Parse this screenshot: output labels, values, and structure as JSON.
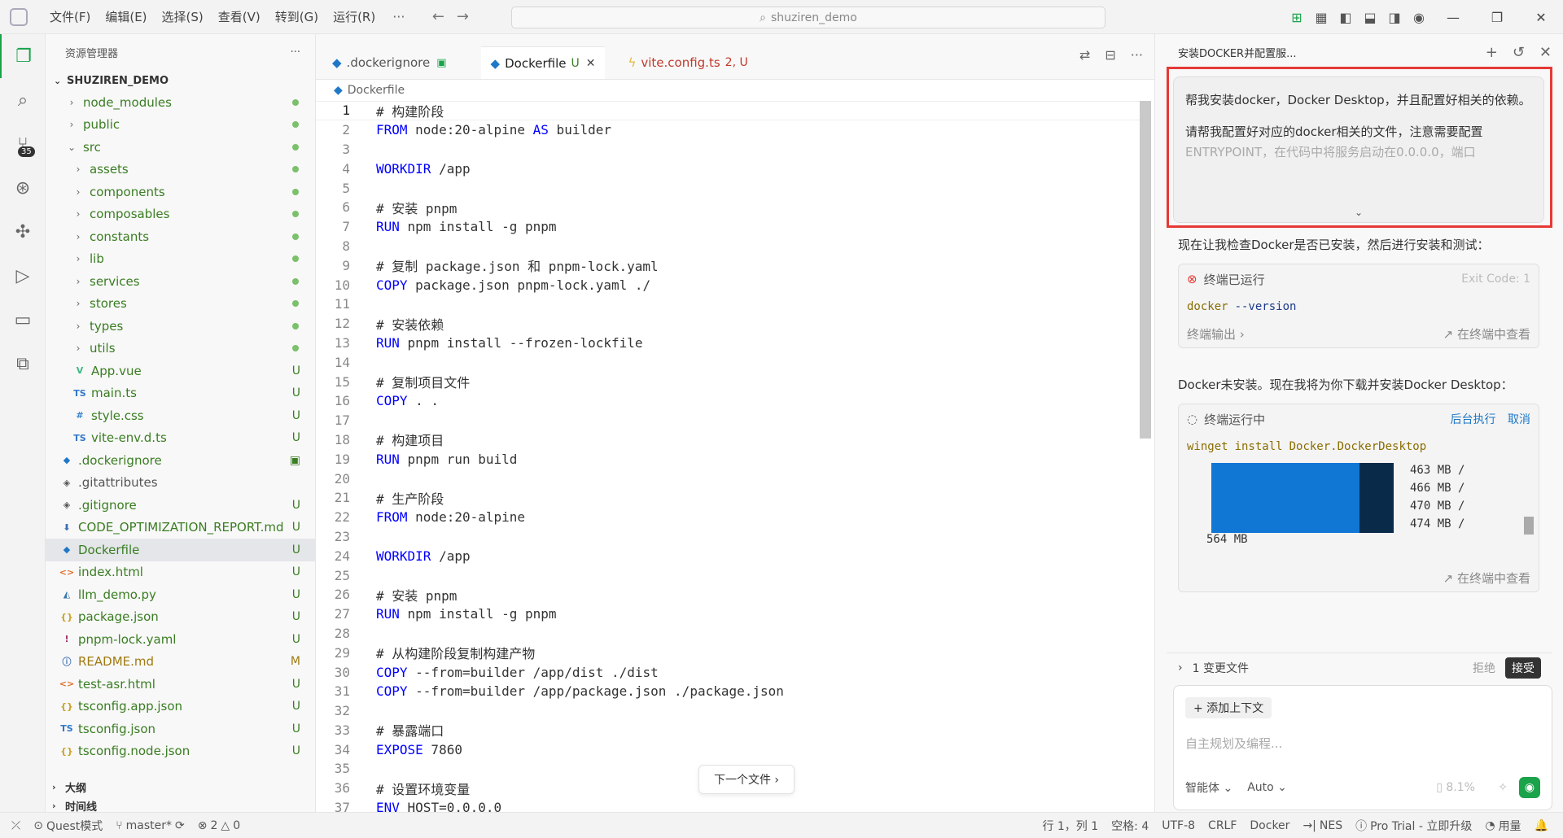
{
  "menu": {
    "items": [
      "文件(F)",
      "编辑(E)",
      "选择(S)",
      "查看(V)",
      "转到(G)",
      "运行(R)"
    ],
    "more": "···",
    "search": "shuziren_demo"
  },
  "sidebar": {
    "title": "资源管理器",
    "more": "···",
    "root": "SHUZIREN_DEMO",
    "items": [
      {
        "name": "node_modules",
        "status": "dot"
      },
      {
        "name": "public",
        "status": "dot"
      },
      {
        "name": "src",
        "status": "dot"
      },
      {
        "name": "assets",
        "status": "dot"
      },
      {
        "name": "components",
        "status": "dot"
      },
      {
        "name": "composables",
        "status": "dot"
      },
      {
        "name": "constants",
        "status": "dot"
      },
      {
        "name": "lib",
        "status": "dot"
      },
      {
        "name": "services",
        "status": "dot"
      },
      {
        "name": "stores",
        "status": "dot"
      },
      {
        "name": "types",
        "status": "dot"
      },
      {
        "name": "utils",
        "status": "dot"
      },
      {
        "name": "App.vue",
        "status": "U"
      },
      {
        "name": "main.ts",
        "status": "U"
      },
      {
        "name": "style.css",
        "status": "U"
      },
      {
        "name": "vite-env.d.ts",
        "status": "U"
      },
      {
        "name": ".dockerignore",
        "status": ""
      },
      {
        "name": ".gitattributes",
        "status": ""
      },
      {
        "name": ".gitignore",
        "status": "U"
      },
      {
        "name": "CODE_OPTIMIZATION_REPORT.md",
        "status": "U"
      },
      {
        "name": "Dockerfile",
        "status": "U"
      },
      {
        "name": "index.html",
        "status": "U"
      },
      {
        "name": "llm_demo.py",
        "status": "U"
      },
      {
        "name": "package.json",
        "status": "U"
      },
      {
        "name": "pnpm-lock.yaml",
        "status": "U"
      },
      {
        "name": "README.md",
        "status": "M"
      },
      {
        "name": "test-asr.html",
        "status": "U"
      },
      {
        "name": "tsconfig.app.json",
        "status": "U"
      },
      {
        "name": "tsconfig.json",
        "status": "U"
      },
      {
        "name": "tsconfig.node.json",
        "status": "U"
      }
    ],
    "outline": "大纲",
    "timeline": "时间线"
  },
  "activity": {
    "badge": "35"
  },
  "tabs": [
    {
      "label": ".dockerignore",
      "status": ""
    },
    {
      "label": "Dockerfile",
      "status": "U"
    },
    {
      "label": "vite.config.ts",
      "status": "2, U"
    }
  ],
  "breadcrumb": "Dockerfile",
  "code": [
    {
      "n": "1",
      "text": "# 构建阶段"
    },
    {
      "n": "2",
      "text": "FROM node:20-alpine AS builder"
    },
    {
      "n": "3",
      "text": ""
    },
    {
      "n": "4",
      "text": "WORKDIR /app"
    },
    {
      "n": "5",
      "text": ""
    },
    {
      "n": "6",
      "text": "# 安装 pnpm"
    },
    {
      "n": "7",
      "text": "RUN npm install -g pnpm"
    },
    {
      "n": "8",
      "text": ""
    },
    {
      "n": "9",
      "text": "# 复制 package.json 和 pnpm-lock.yaml"
    },
    {
      "n": "10",
      "text": "COPY package.json pnpm-lock.yaml ./"
    },
    {
      "n": "11",
      "text": ""
    },
    {
      "n": "12",
      "text": "# 安装依赖"
    },
    {
      "n": "13",
      "text": "RUN pnpm install --frozen-lockfile"
    },
    {
      "n": "14",
      "text": ""
    },
    {
      "n": "15",
      "text": "# 复制项目文件"
    },
    {
      "n": "16",
      "text": "COPY . ."
    },
    {
      "n": "17",
      "text": ""
    },
    {
      "n": "18",
      "text": "# 构建项目"
    },
    {
      "n": "19",
      "text": "RUN pnpm run build"
    },
    {
      "n": "20",
      "text": ""
    },
    {
      "n": "21",
      "text": "# 生产阶段"
    },
    {
      "n": "22",
      "text": "FROM node:20-alpine"
    },
    {
      "n": "23",
      "text": ""
    },
    {
      "n": "24",
      "text": "WORKDIR /app"
    },
    {
      "n": "25",
      "text": ""
    },
    {
      "n": "26",
      "text": "# 安装 pnpm"
    },
    {
      "n": "27",
      "text": "RUN npm install -g pnpm"
    },
    {
      "n": "28",
      "text": ""
    },
    {
      "n": "29",
      "text": "# 从构建阶段复制构建产物"
    },
    {
      "n": "30",
      "text": "COPY --from=builder /app/dist ./dist"
    },
    {
      "n": "31",
      "text": "COPY --from=builder /app/package.json ./package.json"
    },
    {
      "n": "32",
      "text": ""
    },
    {
      "n": "33",
      "text": "# 暴露端口"
    },
    {
      "n": "34",
      "text": "EXPOSE 7860"
    },
    {
      "n": "35",
      "text": ""
    },
    {
      "n": "36",
      "text": "# 设置环境变量"
    },
    {
      "n": "37",
      "text": "ENV HOST=0.0.0.0"
    }
  ],
  "next_file": "下一个文件 ›",
  "chat": {
    "title": "安装DOCKER并配置服...",
    "user_msg_line1": "帮我安装docker，Docker Desktop，并且配置好相关的依赖。",
    "user_msg_line2": "请帮我配置好对应的docker相关的文件，注意需要配置",
    "user_msg_line3": "ENTRYPOINT，在代码中将服务启动在0.0.0.0，端口",
    "ai_msg1": "现在让我检查Docker是否已安装，然后进行安装和测试：",
    "term1": {
      "title": "终端已运行",
      "exit": "Exit Code: 1",
      "cmd_a": "docker",
      "cmd_b": "--version",
      "output_label": "终端输出 ›",
      "view": "在终端中查看"
    },
    "ai_msg2": "Docker未安装。现在我将为你下载并安装Docker Desktop：",
    "term2": {
      "title": "终端运行中",
      "bg": "后台执行",
      "cancel": "取消",
      "cmd_a": "winget",
      "cmd_b": "install",
      "cmd_c": "Docker.DockerDesktop",
      "progress": [
        "463 MB /",
        "466 MB /",
        "470 MB /",
        "474 MB /"
      ],
      "total": "564 MB",
      "view": "在终端中查看"
    },
    "changed": "1 变更文件",
    "reject": "拒绝",
    "accept": "接受",
    "add_context": "+ 添加上下文",
    "placeholder": "自主规划及编程...",
    "agent": "智能体",
    "model": "Auto",
    "usage": "8.1%"
  },
  "status": {
    "mode": "Quest模式",
    "branch": "master*",
    "errors": "2",
    "warnings": "0",
    "position": "行 1，列 1",
    "spaces": "空格: 4",
    "encoding": "UTF-8",
    "eol": "CRLF",
    "lang": "Docker",
    "nes": "NES",
    "pro": "Pro Trial - 立即升级",
    "usage": "用量"
  }
}
